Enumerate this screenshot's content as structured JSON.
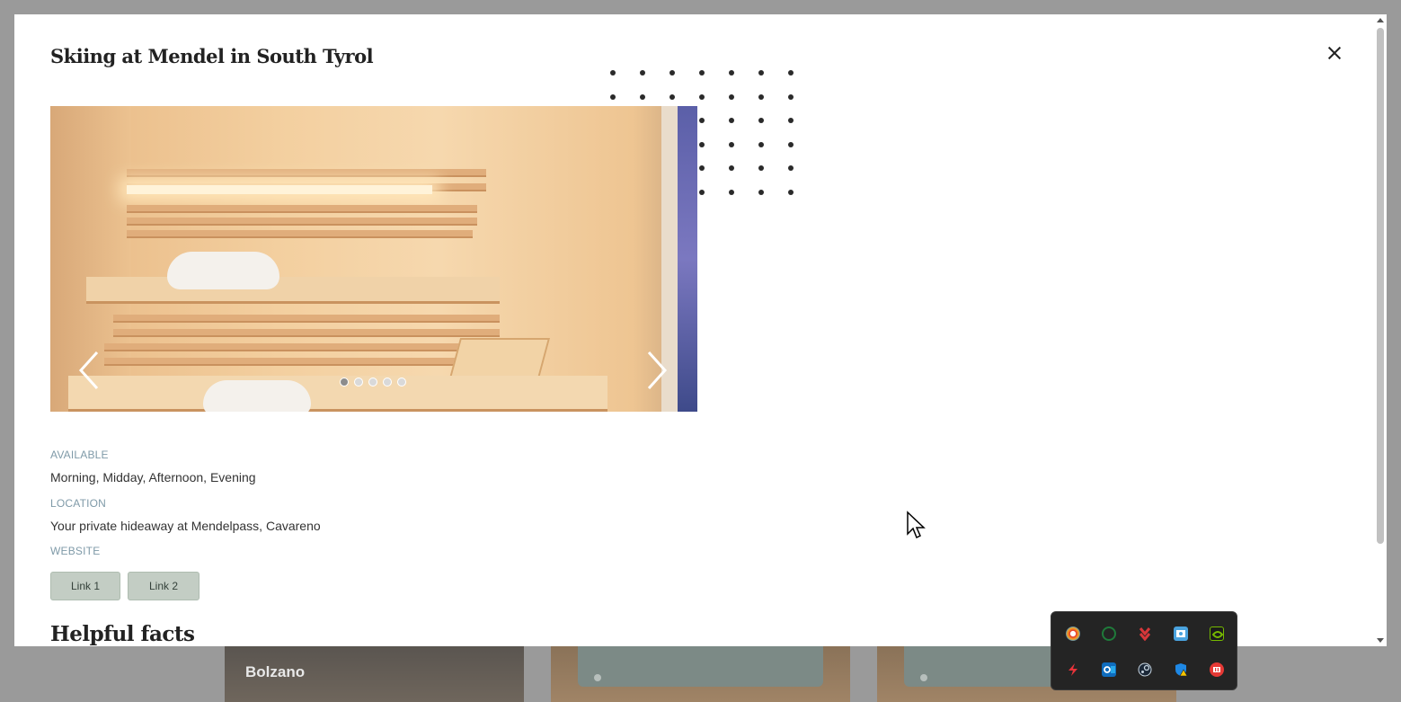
{
  "background_cards": [
    {
      "label": "Bolzano"
    },
    {
      "label": ""
    },
    {
      "label": ""
    }
  ],
  "modal": {
    "title": "Skiing at Mendel in South Tyrol",
    "carousel": {
      "slide_count": 5,
      "active_index": 0,
      "image_subject": "wooden sauna interior"
    },
    "info": {
      "available_label": "AVAILABLE",
      "available_value": "Morning, Midday, Afternoon, Evening",
      "location_label": "LOCATION",
      "location_value": "Your private hideaway at Mendelpass, Cavareno",
      "website_label": "WEBSITE"
    },
    "buttons": {
      "link1": "Link 1",
      "link2": "Link 2"
    },
    "section_heading": "Helpful facts"
  },
  "tray": {
    "icons": [
      "browser-icon",
      "xbox-icon",
      "download-manager-icon",
      "mail-client-icon",
      "nvidia-icon",
      "lightning-icon",
      "outlook-icon",
      "steam-icon",
      "security-warning-icon",
      "red-app-icon"
    ]
  },
  "colors": {
    "button_bg": "#c3cdc4",
    "label_color": "#7f9aa8",
    "overlay": "#9a9a9a"
  }
}
